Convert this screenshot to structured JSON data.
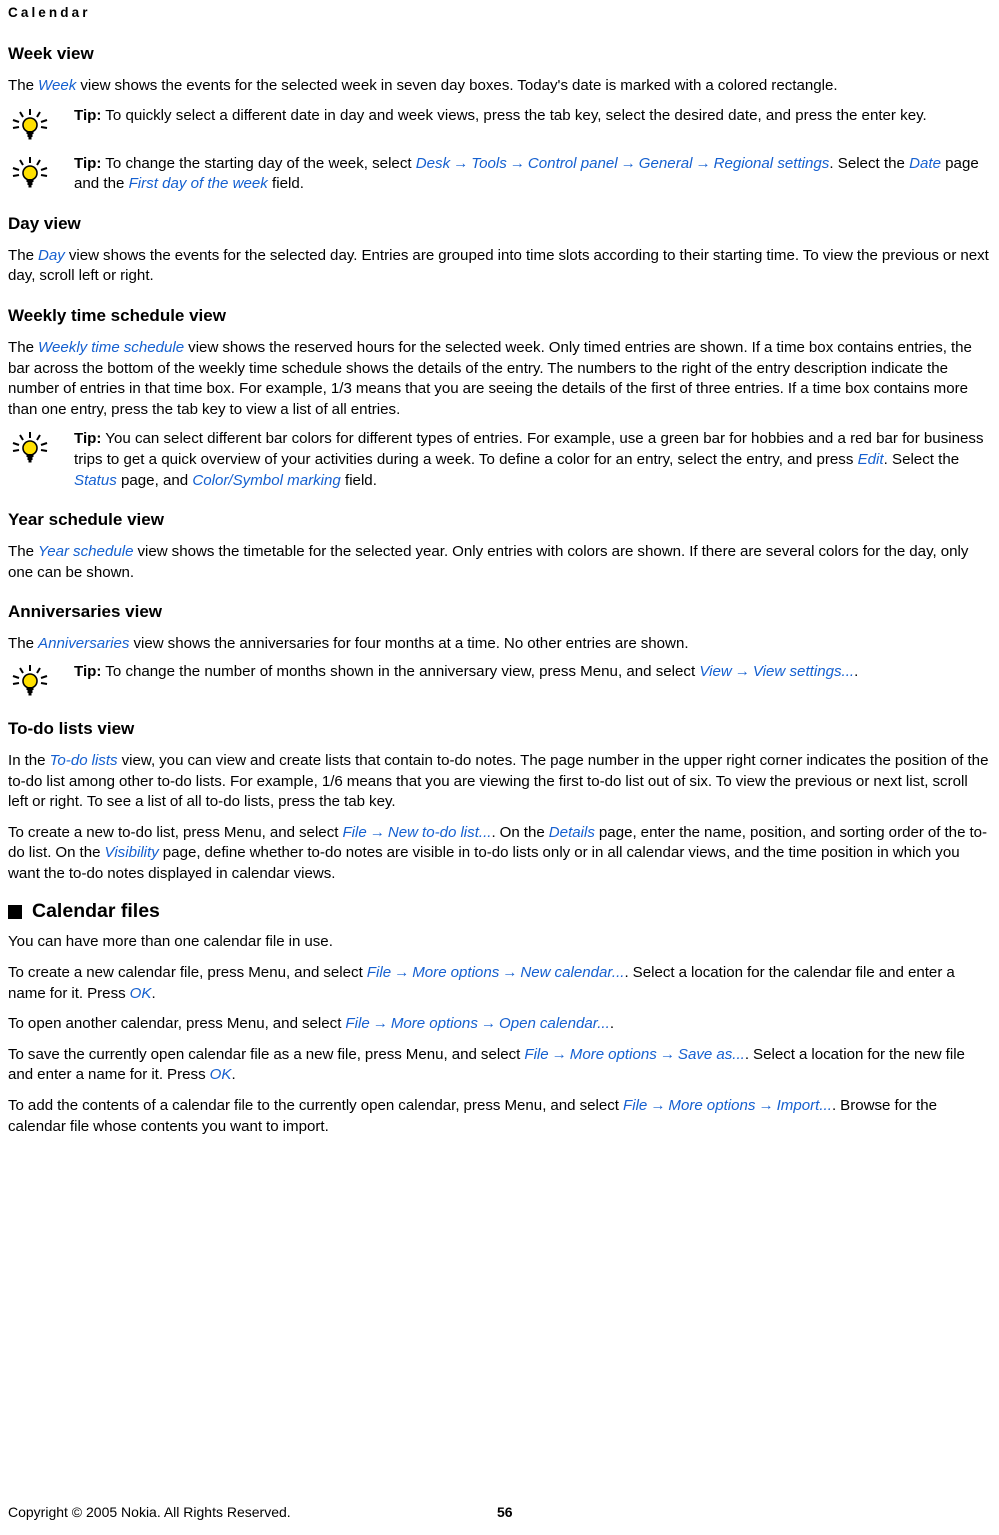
{
  "running_head": "Calendar",
  "colors": {
    "link_blue": "#1560D0",
    "text_black": "#000000",
    "bulb_yellow": "#FFE000",
    "page_background": "#FFFFFF"
  },
  "icons": {
    "tip_bulb": "lightbulb-icon",
    "square_bullet": "square-bullet-icon",
    "arrow": "→"
  },
  "sections": {
    "week_view": {
      "heading": "Week view",
      "paragraph": {
        "pre": "The ",
        "link": "Week",
        "post": " view shows the events for the selected week in seven day boxes. Today's date is marked with a colored rectangle."
      },
      "tip1": {
        "label": "Tip:",
        "text": " To quickly select a different date in day and week views, press the tab key, select the desired date, and press the enter key."
      },
      "tip2": {
        "label": "Tip:",
        "text_1": "  To change the starting day of the week, select ",
        "link_1": "Desk",
        "link_2": "Tools",
        "link_3": "Control panel",
        "link_4": "General",
        "link_5": "Regional settings",
        "text_2": ". Select the ",
        "link_6": "Date",
        "text_3": " page and the ",
        "link_7": "First day of the week",
        "text_4": " field."
      }
    },
    "day_view": {
      "heading": "Day view",
      "paragraph": {
        "pre": "The ",
        "link": "Day",
        "post": " view shows the events for the selected day. Entries are grouped into time slots according to their starting time. To view the previous or next day, scroll left or right."
      }
    },
    "weekly_time_schedule_view": {
      "heading": "Weekly time schedule view",
      "paragraph": {
        "pre": "The ",
        "link": "Weekly time schedule",
        "post": " view shows the reserved hours for the selected week. Only timed entries are shown. If a time box contains entries, the bar across the bottom of the weekly time schedule shows the details of the entry. The numbers to the right of the entry description indicate the number of entries in that time box. For example, 1/3 means that you are seeing the details of the first of three entries. If a time box contains more than one entry, press the tab key to view a list of all entries."
      },
      "tip": {
        "label": "Tip:",
        "text_1": "  You can select different bar colors for different types of entries. For example, use a green bar for hobbies and a red bar for business trips to get a quick overview of your activities during a week. To define a color for an entry, select the entry, and press ",
        "link_1": "Edit",
        "text_2": ". Select the ",
        "link_2": "Status",
        "text_3": " page, and ",
        "link_3": "Color/Symbol marking",
        "text_4": " field."
      }
    },
    "year_schedule_view": {
      "heading": "Year schedule view",
      "paragraph": {
        "pre": "The ",
        "link": "Year schedule",
        "post": " view shows the timetable for the selected year. Only entries with colors are shown. If there are several colors for the day, only one can be shown."
      }
    },
    "anniversaries_view": {
      "heading": "Anniversaries view",
      "paragraph": {
        "pre": "The ",
        "link": "Anniversaries",
        "post": " view shows the anniversaries for four months at a time. No other entries are shown."
      },
      "tip": {
        "label": "Tip:",
        "text_1": "  To change the number of months shown in the anniversary view, press Menu, and select ",
        "link_1": "View",
        "link_2": "View settings...",
        "text_2": "."
      }
    },
    "todo_lists_view": {
      "heading": "To-do lists view",
      "paragraph_1": {
        "pre": "In the ",
        "link": "To-do lists",
        "post": " view, you can view and create lists that contain to-do notes. The page number in the upper right corner indicates the position of the to-do list among other to-do lists. For example, 1/6 means that you are viewing the first to-do list out of six. To view the previous or next list, scroll left or right. To see a list of all to-do lists, press the tab key."
      },
      "paragraph_2": {
        "text_1": "To create a new to-do list, press Menu, and select ",
        "link_1": "File",
        "link_2": "New to-do list...",
        "text_2": ". On the ",
        "link_3": "Details",
        "text_3": " page, enter the name, position, and sorting order of the to-do list. On the ",
        "link_4": "Visibility",
        "text_4": " page, define whether to-do notes are visible in to-do lists only or in all calendar views, and the time position in which you want the to-do notes displayed in calendar views."
      }
    },
    "calendar_files": {
      "heading": "Calendar files",
      "paragraph_1": "You can have more than one calendar file in use.",
      "paragraph_2": {
        "text_1": "To create a new calendar file, press Menu, and select ",
        "link_1": "File",
        "link_2": "More options",
        "link_3": "New calendar...",
        "text_2": ". Select a location for the calendar file and enter a name for it. Press ",
        "link_4": "OK",
        "text_3": "."
      },
      "paragraph_3": {
        "text_1": "To open another calendar, press Menu, and select ",
        "link_1": "File",
        "link_2": "More options",
        "link_3": "Open calendar...",
        "text_2": "."
      },
      "paragraph_4": {
        "text_1": "To save the currently open calendar file as a new file, press Menu, and select ",
        "link_1": "File",
        "link_2": "More options",
        "link_3": "Save as...",
        "text_2": ". Select a location for the new file and enter a name for it. Press ",
        "link_4": "OK",
        "text_3": "."
      },
      "paragraph_5": {
        "text_1": "To add the contents of a calendar file to the currently open calendar, press Menu, and select ",
        "link_1": "File",
        "link_2": "More options",
        "link_3": "Import...",
        "text_2": ". Browse for the calendar file whose contents you want to import."
      }
    }
  },
  "footer": {
    "copyright": "Copyright © 2005 Nokia. All Rights Reserved.",
    "page_number": "56"
  }
}
